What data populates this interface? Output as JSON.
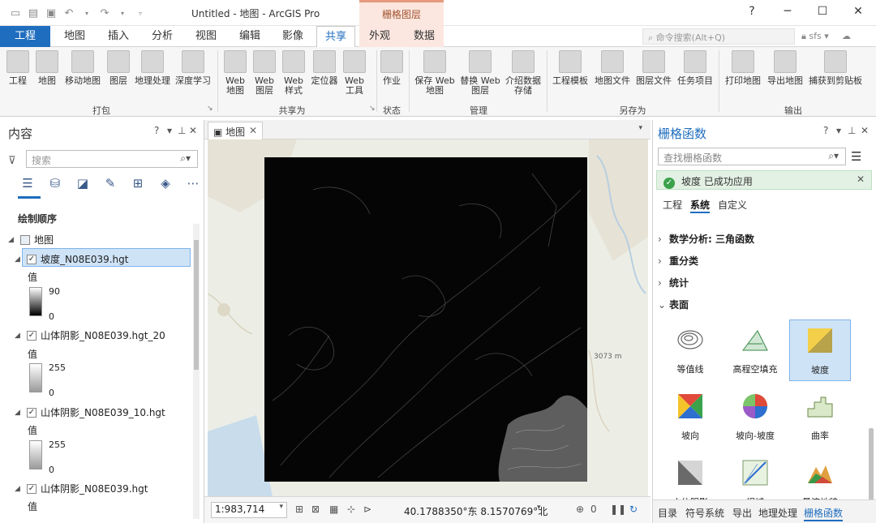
{
  "title_bar": {
    "app_title": "Untitled - 地图 - ArcGIS Pro",
    "context_header": "栅格图层",
    "help": "?",
    "minimize": "─",
    "maximize": "☐",
    "close": "✕"
  },
  "ribbon_tabs": [
    "工程",
    "地图",
    "插入",
    "分析",
    "视图",
    "编辑",
    "影像",
    "共享",
    "外观",
    "数据"
  ],
  "active_tab": "共享",
  "command_search": {
    "placeholder": "命令搜索(Alt+Q)"
  },
  "user": {
    "name": "sfs"
  },
  "ribbon": {
    "groups": [
      {
        "label": "打包",
        "buttons": [
          "工程",
          "地图",
          "移动地图",
          "图层",
          "地理处理",
          "深度学习"
        ]
      },
      {
        "label": "共享为",
        "buttons": [
          "Web 地图",
          "Web 图层",
          "Web 样式",
          "定位器",
          "Web 工具"
        ]
      },
      {
        "label": "状态",
        "buttons": [
          "作业"
        ]
      },
      {
        "label": "管理",
        "buttons": [
          "保存 Web 地图",
          "替换 Web 图层",
          "介绍数据存储"
        ]
      },
      {
        "label": "另存为",
        "buttons": [
          "工程模板",
          "地图文件",
          "图层文件",
          "任务项目"
        ]
      },
      {
        "label": "输出",
        "buttons": [
          "打印地图",
          "导出地图",
          "捕获到剪贴板"
        ]
      }
    ]
  },
  "contents_pane": {
    "title": "内容",
    "search_placeholder": "搜索",
    "section": "绘制顺序",
    "map_name": "地图",
    "value_label": "值",
    "layers": [
      {
        "name": "坡度_N08E039.hgt",
        "high": "90",
        "low": "0"
      },
      {
        "name": "山体阴影_N08E039.hgt_20",
        "high": "255",
        "low": "0"
      },
      {
        "name": "山体阴影_N08E039_10.hgt",
        "high": "255",
        "low": "0"
      },
      {
        "name": "山体阴影_N08E039.hgt",
        "high": "",
        "low": ""
      }
    ]
  },
  "map_view": {
    "tab_label": "地图",
    "elevation_label": "3073 m",
    "scale": "1:983,714",
    "coordinates": "40.1788350°东 8.1570769°北",
    "selected_count": "0"
  },
  "raster_functions": {
    "title": "栅格函数",
    "search_placeholder": "查找栅格函数",
    "success_message": "坡度 已成功应用",
    "tabs": [
      "工程",
      "系统",
      "自定义"
    ],
    "active_tab": "系统",
    "categories": [
      "数学分析: 三角函数",
      "重分类",
      "统计",
      "表面"
    ],
    "tiles": [
      {
        "label": "等值线",
        "icon": "contour-icon"
      },
      {
        "label": "高程空填充",
        "icon": "elevation-void-fill-icon"
      },
      {
        "label": "坡度",
        "icon": "slope-icon"
      },
      {
        "label": "坡向",
        "icon": "aspect-icon"
      },
      {
        "label": "坡向-坡度",
        "icon": "aspect-slope-icon"
      },
      {
        "label": "曲率",
        "icon": "curvature-icon"
      },
      {
        "label": "山体阴影",
        "icon": "hillshade-icon"
      },
      {
        "label": "视域",
        "icon": "viewshed-icon"
      },
      {
        "label": "晕渲地貌",
        "icon": "shaded-relief-icon"
      }
    ],
    "selected_tile": "坡度",
    "bottom_tabs": [
      "目录",
      "符号系统",
      "导出",
      "地理处理",
      "栅格函数"
    ],
    "active_bottom_tab": "栅格函数"
  },
  "colors": {
    "accent": "#1f6dbe",
    "context_tab": "#fbe7e0",
    "success_bg": "#e3f1e4",
    "selection": "#cfe3f7"
  }
}
